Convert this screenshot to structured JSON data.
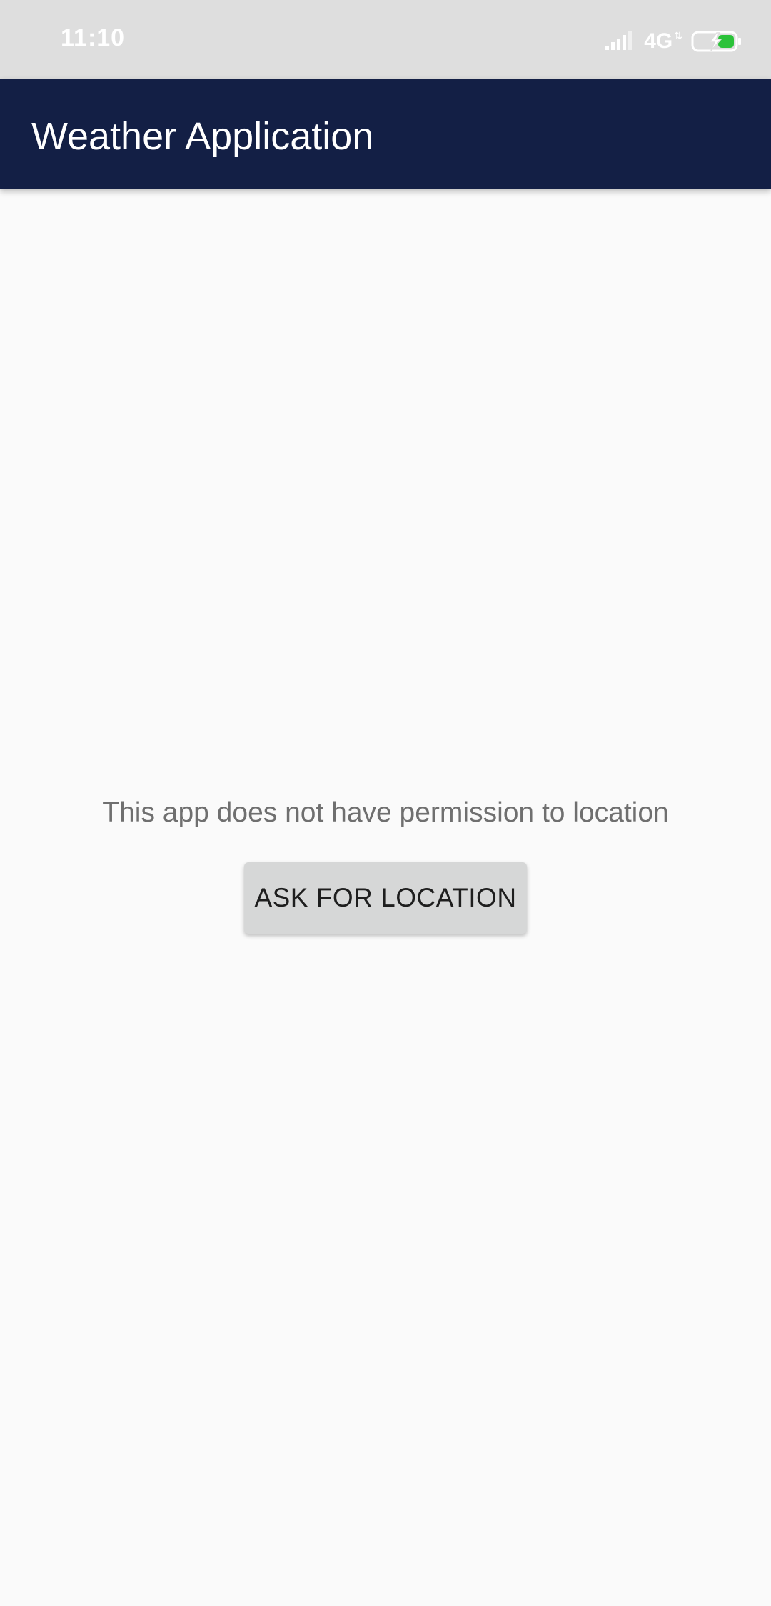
{
  "status_bar": {
    "time": "11:10",
    "network_type": "4G",
    "network_arrows": "⇅",
    "icons": [
      "signal-icon",
      "battery-charging-icon"
    ],
    "battery_color": "#2bc239"
  },
  "app_bar": {
    "title": "Weather Application",
    "background_color": "#131f45"
  },
  "main": {
    "message": "This app does not have permission to location",
    "ask_button_label": "ASK FOR LOCATION"
  },
  "colors": {
    "background": "#fafafa",
    "button": "#d6d7d7",
    "message_text": "#6f6f6f"
  }
}
